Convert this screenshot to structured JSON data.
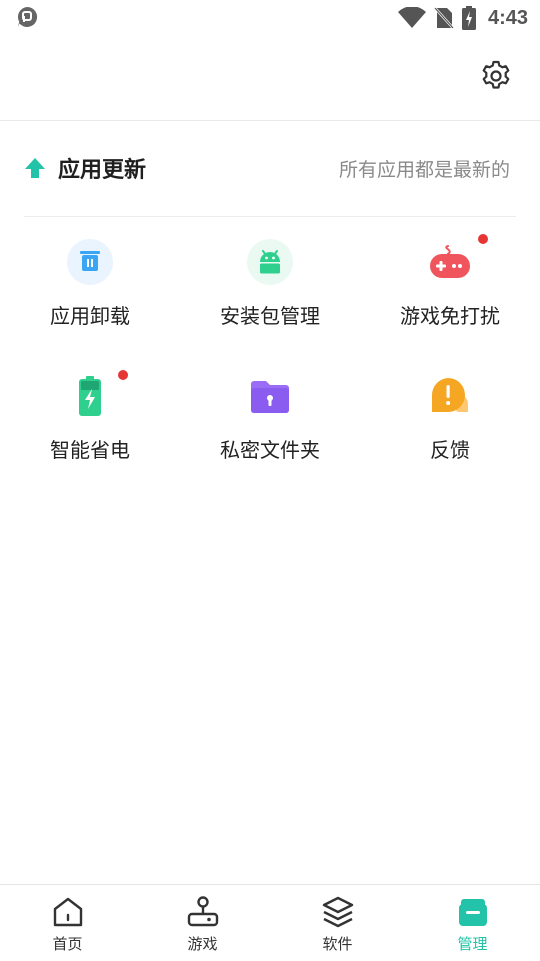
{
  "status_bar": {
    "time": "4:43"
  },
  "update": {
    "title": "应用更新",
    "status": "所有应用都是最新的"
  },
  "tools": [
    {
      "label": "应用卸载",
      "icon": "uninstall-trash-icon",
      "badge": false
    },
    {
      "label": "安装包管理",
      "icon": "android-package-icon",
      "badge": false
    },
    {
      "label": "游戏免打扰",
      "icon": "gamepad-icon",
      "badge": true
    },
    {
      "label": "智能省电",
      "icon": "battery-charging-icon",
      "badge": true
    },
    {
      "label": "私密文件夹",
      "icon": "lock-folder-icon",
      "badge": false
    },
    {
      "label": "反馈",
      "icon": "feedback-bubble-icon",
      "badge": false
    }
  ],
  "bottom_nav": [
    {
      "label": "首页",
      "icon": "home-icon",
      "active": false
    },
    {
      "label": "游戏",
      "icon": "joystick-icon",
      "active": false
    },
    {
      "label": "软件",
      "icon": "layers-icon",
      "active": false
    },
    {
      "label": "管理",
      "icon": "manage-box-icon",
      "active": true
    }
  ],
  "colors": {
    "accent": "#22c3a8",
    "badge": "#e63535",
    "game_red": "#f0545c",
    "battery_green": "#2fcf8e",
    "folder_purple": "#9b6cf6",
    "feedback_orange": "#f5a623",
    "trash_blue": "#3aa5f5"
  }
}
